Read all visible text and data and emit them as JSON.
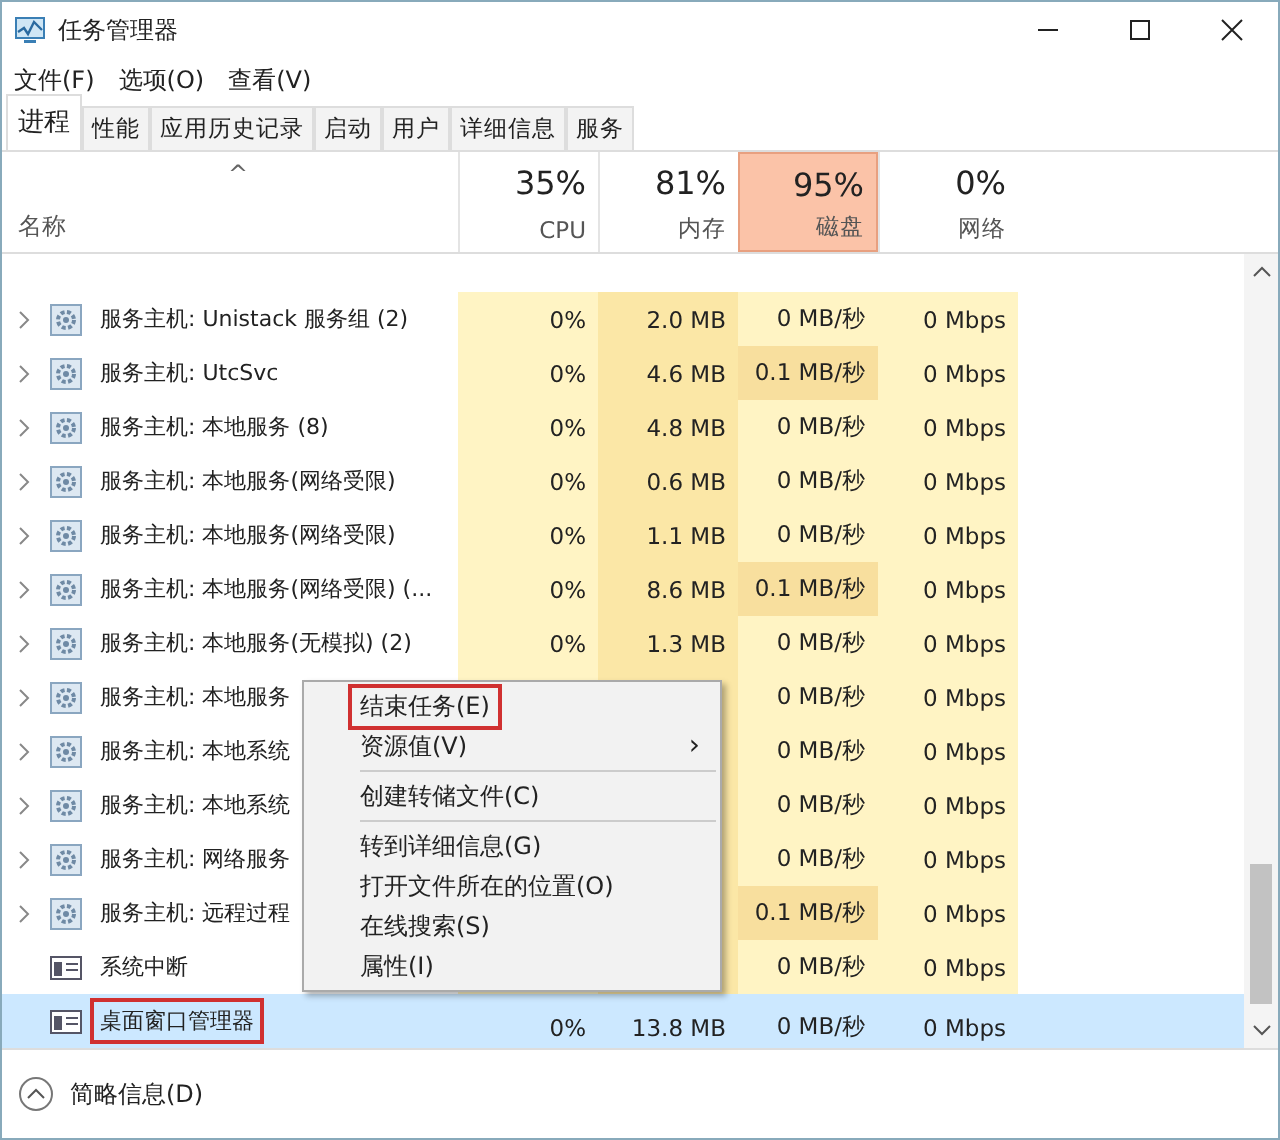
{
  "window": {
    "title": "任务管理器"
  },
  "menu_bar": [
    "文件(F)",
    "选项(O)",
    "查看(V)"
  ],
  "tabs": [
    {
      "label": "进程",
      "selected": true
    },
    {
      "label": "性能",
      "selected": false
    },
    {
      "label": "应用历史记录",
      "selected": false
    },
    {
      "label": "启动",
      "selected": false
    },
    {
      "label": "用户",
      "selected": false
    },
    {
      "label": "详细信息",
      "selected": false
    },
    {
      "label": "服务",
      "selected": false
    }
  ],
  "sort_arrow": "^",
  "columns": [
    {
      "label": "名称"
    },
    {
      "percent": "35%",
      "label": "CPU",
      "hot": false
    },
    {
      "percent": "81%",
      "label": "内存",
      "hot": false
    },
    {
      "percent": "95%",
      "label": "磁盘",
      "hot": true
    },
    {
      "percent": "0%",
      "label": "网络",
      "hot": false
    }
  ],
  "rows": [
    {
      "kind": "service",
      "name": "服务主机: Unistack 服务组 (2)",
      "cpu": "0%",
      "memory": "2.0 MB",
      "disk": "0 MB/秒",
      "disk_hot": false,
      "network": "0 Mbps",
      "selected": false,
      "annotated": false
    },
    {
      "kind": "service",
      "name": "服务主机: UtcSvc",
      "cpu": "0%",
      "memory": "4.6 MB",
      "disk": "0.1 MB/秒",
      "disk_hot": true,
      "network": "0 Mbps",
      "selected": false,
      "annotated": false
    },
    {
      "kind": "service",
      "name": "服务主机: 本地服务 (8)",
      "cpu": "0%",
      "memory": "4.8 MB",
      "disk": "0 MB/秒",
      "disk_hot": false,
      "network": "0 Mbps",
      "selected": false,
      "annotated": false
    },
    {
      "kind": "service",
      "name": "服务主机: 本地服务(网络受限)",
      "cpu": "0%",
      "memory": "0.6 MB",
      "disk": "0 MB/秒",
      "disk_hot": false,
      "network": "0 Mbps",
      "selected": false,
      "annotated": false
    },
    {
      "kind": "service",
      "name": "服务主机: 本地服务(网络受限)",
      "cpu": "0%",
      "memory": "1.1 MB",
      "disk": "0 MB/秒",
      "disk_hot": false,
      "network": "0 Mbps",
      "selected": false,
      "annotated": false
    },
    {
      "kind": "service",
      "name": "服务主机: 本地服务(网络受限) (...",
      "cpu": "0%",
      "memory": "8.6 MB",
      "disk": "0.1 MB/秒",
      "disk_hot": true,
      "network": "0 Mbps",
      "selected": false,
      "annotated": false
    },
    {
      "kind": "service",
      "name": "服务主机: 本地服务(无模拟) (2)",
      "cpu": "0%",
      "memory": "1.3 MB",
      "disk": "0 MB/秒",
      "disk_hot": false,
      "network": "0 Mbps",
      "selected": false,
      "annotated": false
    },
    {
      "kind": "service",
      "name": "服务主机: 本地服务",
      "disk": "0 MB/秒",
      "disk_hot": false,
      "network": "0 Mbps",
      "selected": false,
      "annotated": false
    },
    {
      "kind": "service",
      "name": "服务主机: 本地系统",
      "disk": "0 MB/秒",
      "disk_hot": false,
      "network": "0 Mbps",
      "selected": false,
      "annotated": false
    },
    {
      "kind": "service",
      "name": "服务主机: 本地系统",
      "disk": "0 MB/秒",
      "disk_hot": false,
      "network": "0 Mbps",
      "selected": false,
      "annotated": false
    },
    {
      "kind": "service",
      "name": "服务主机: 网络服务",
      "disk": "0 MB/秒",
      "disk_hot": false,
      "network": "0 Mbps",
      "selected": false,
      "annotated": false
    },
    {
      "kind": "service",
      "name": "服务主机: 远程过程",
      "disk": "0.1 MB/秒",
      "disk_hot": true,
      "network": "0 Mbps",
      "selected": false,
      "annotated": false
    },
    {
      "kind": "app",
      "name": "系统中断",
      "disk": "0 MB/秒",
      "disk_hot": false,
      "network": "0 Mbps",
      "selected": false,
      "annotated": false
    },
    {
      "kind": "app",
      "name": "桌面窗口管理器",
      "cpu": "0%",
      "memory": "13.8 MB",
      "disk": "0 MB/秒",
      "disk_hot": false,
      "network": "0 Mbps",
      "selected": true,
      "annotated": true
    }
  ],
  "context_menu": [
    {
      "kind": "item",
      "label": "结束任务(E)",
      "annotated": true
    },
    {
      "kind": "submenu",
      "label": "资源值(V)",
      "arrow": "›",
      "annotated": false
    },
    {
      "kind": "separator"
    },
    {
      "kind": "item",
      "label": "创建转储文件(C)",
      "annotated": false
    },
    {
      "kind": "separator"
    },
    {
      "kind": "item",
      "label": "转到详细信息(G)",
      "annotated": false
    },
    {
      "kind": "item",
      "label": "打开文件所在的位置(O)",
      "annotated": false
    },
    {
      "kind": "item",
      "label": "在线搜索(S)",
      "annotated": false
    },
    {
      "kind": "item",
      "label": "属性(I)",
      "annotated": false
    }
  ],
  "footer": {
    "label": "简略信息(D)"
  }
}
